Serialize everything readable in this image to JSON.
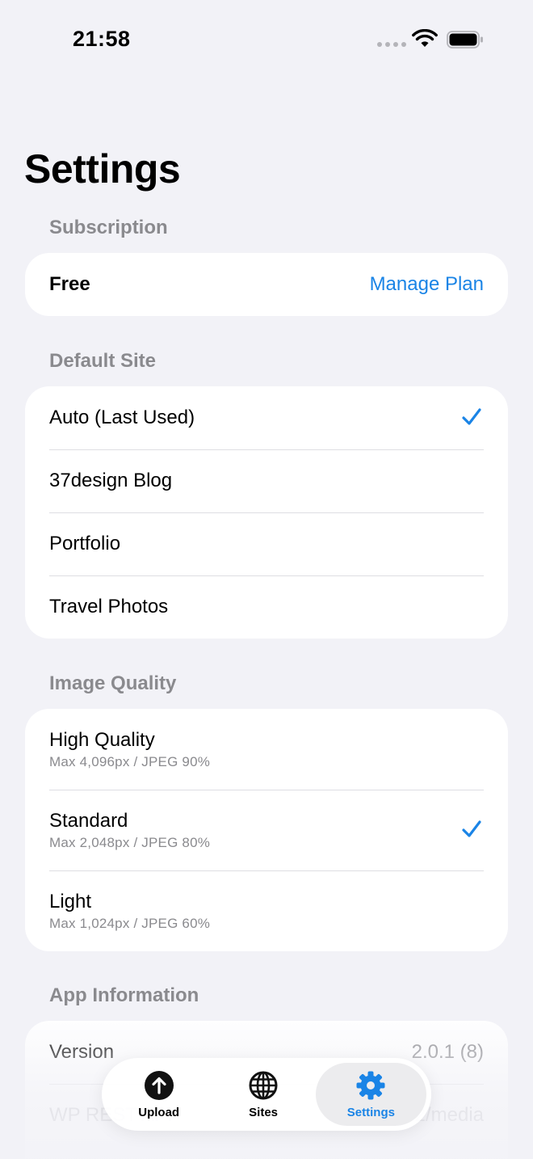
{
  "status": {
    "time": "21:58"
  },
  "page": {
    "title": "Settings"
  },
  "subscription": {
    "header": "Subscription",
    "plan": "Free",
    "manage_label": "Manage Plan"
  },
  "default_site": {
    "header": "Default Site",
    "items": [
      {
        "label": "Auto (Last Used)",
        "selected": true
      },
      {
        "label": "37design Blog",
        "selected": false
      },
      {
        "label": "Portfolio",
        "selected": false
      },
      {
        "label": "Travel Photos",
        "selected": false
      }
    ]
  },
  "image_quality": {
    "header": "Image Quality",
    "items": [
      {
        "label": "High Quality",
        "detail": "Max 4,096px / JPEG 90%",
        "selected": false
      },
      {
        "label": "Standard",
        "detail": "Max 2,048px / JPEG 80%",
        "selected": true
      },
      {
        "label": "Light",
        "detail": "Max 1,024px / JPEG 60%",
        "selected": false
      }
    ]
  },
  "app_info": {
    "header": "App Information",
    "version_label": "Version",
    "version_value": "2.0.1 (8)",
    "wp_label": "WP REST API",
    "wp_value": "/wp/v2/media"
  },
  "tabs": [
    {
      "label": "Upload",
      "icon": "upload-icon",
      "active": false
    },
    {
      "label": "Sites",
      "icon": "globe-icon",
      "active": false
    },
    {
      "label": "Settings",
      "icon": "gear-icon",
      "active": true
    }
  ],
  "colors": {
    "accent": "#1a84e6",
    "background": "#f2f2f7",
    "secondary": "#8a8a8e"
  }
}
